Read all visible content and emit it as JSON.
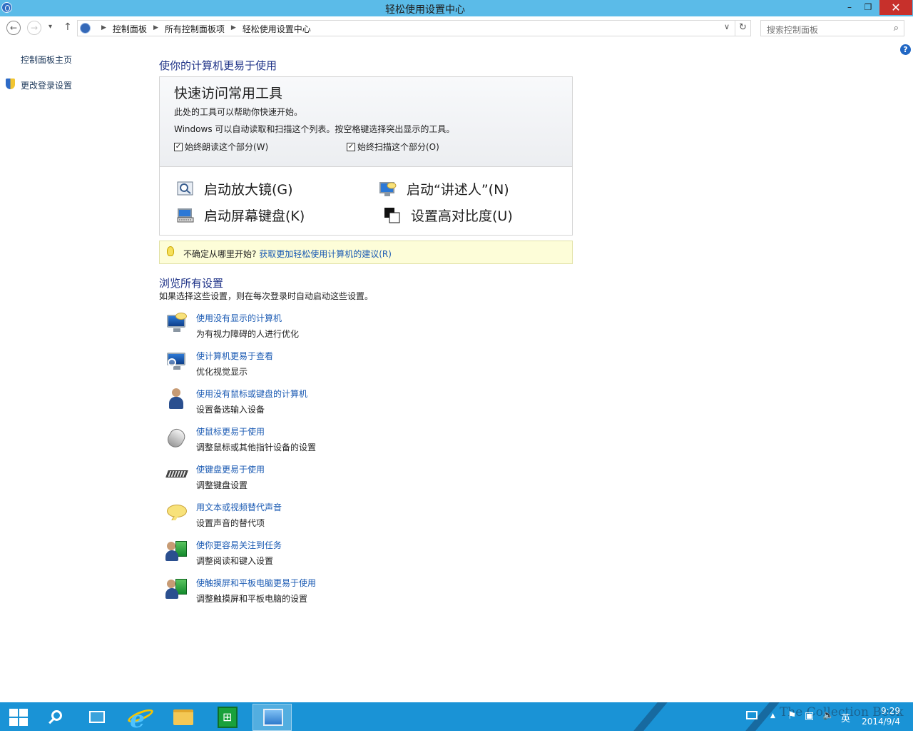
{
  "window": {
    "title": "轻松使用设置中心",
    "minimize": "–",
    "maximize": "❐",
    "close": "✕"
  },
  "nav": {
    "back": "←",
    "forward": "→",
    "recent": "▾",
    "up": "↑",
    "breadcrumbs": [
      "控制面板",
      "所有控制面板项",
      "轻松使用设置中心"
    ],
    "dropdown": "∨",
    "refresh": "↻",
    "search_placeholder": "搜索控制面板",
    "search_icon": "⌕"
  },
  "help": "?",
  "sidebar": {
    "items": [
      {
        "label": "控制面板主页"
      },
      {
        "label": "更改登录设置"
      }
    ]
  },
  "main": {
    "heading": "使你的计算机更易于使用",
    "quick": {
      "title": "快速访问常用工具",
      "desc1": "此处的工具可以帮助你快速开始。",
      "desc2": "Windows 可以自动读取和扫描这个列表。按空格键选择突出显示的工具。",
      "check_read": {
        "label": "始终朗读这个部分(W)",
        "checked": true
      },
      "check_scan": {
        "label": "始终扫描这个部分(O)",
        "checked": true
      },
      "tools": [
        {
          "label": "启动放大镜(G)",
          "icon": "magnifier-icon"
        },
        {
          "label": "启动“讲述人”(N)",
          "icon": "narrator-icon"
        },
        {
          "label": "启动屏幕键盘(K)",
          "icon": "on-screen-keyboard-icon"
        },
        {
          "label": "设置高对比度(U)",
          "icon": "high-contrast-icon"
        }
      ],
      "check_mark": "✓"
    },
    "tip": {
      "text": "不确定从哪里开始?",
      "link": "获取更加轻松使用计算机的建议(R)"
    },
    "browse": {
      "heading": "浏览所有设置",
      "desc": "如果选择这些设置，则在每次登录时自动启动这些设置。",
      "items": [
        {
          "link": "使用没有显示的计算机",
          "sub": "为有视力障碍的人进行优化",
          "icon": "no-display-icon"
        },
        {
          "link": "使计算机更易于查看",
          "sub": "优化视觉显示",
          "icon": "easier-to-see-icon"
        },
        {
          "link": "使用没有鼠标或键盘的计算机",
          "sub": "设置备选输入设备",
          "icon": "alt-input-icon"
        },
        {
          "link": "使鼠标更易于使用",
          "sub": "调整鼠标或其他指针设备的设置",
          "icon": "mouse-icon"
        },
        {
          "link": "使键盘更易于使用",
          "sub": "调整键盘设置",
          "icon": "keyboard-icon"
        },
        {
          "link": "用文本或视频替代声音",
          "sub": "设置声音的替代项",
          "icon": "speech-bubble-icon"
        },
        {
          "link": "使你更容易关注到任务",
          "sub": "调整阅读和键入设置",
          "icon": "focus-tasks-icon"
        },
        {
          "link": "使触摸屏和平板电脑更易于使用",
          "sub": "调整触摸屏和平板电脑的设置",
          "icon": "touch-tablet-icon"
        }
      ]
    }
  },
  "taskbar": {
    "tray_lang": "英",
    "time": "9:29",
    "date": "2014/9/4",
    "tray_up": "▲",
    "tray_flag": "⚑",
    "tray_network": "▣",
    "tray_volume": "🔈",
    "watermark": "The Collection Book"
  },
  "colors": {
    "titlebar": "#5bbbe8",
    "taskbar": "#1a93d6",
    "link": "#1a5ab3",
    "heading": "#1e3287",
    "close": "#c7302b"
  }
}
